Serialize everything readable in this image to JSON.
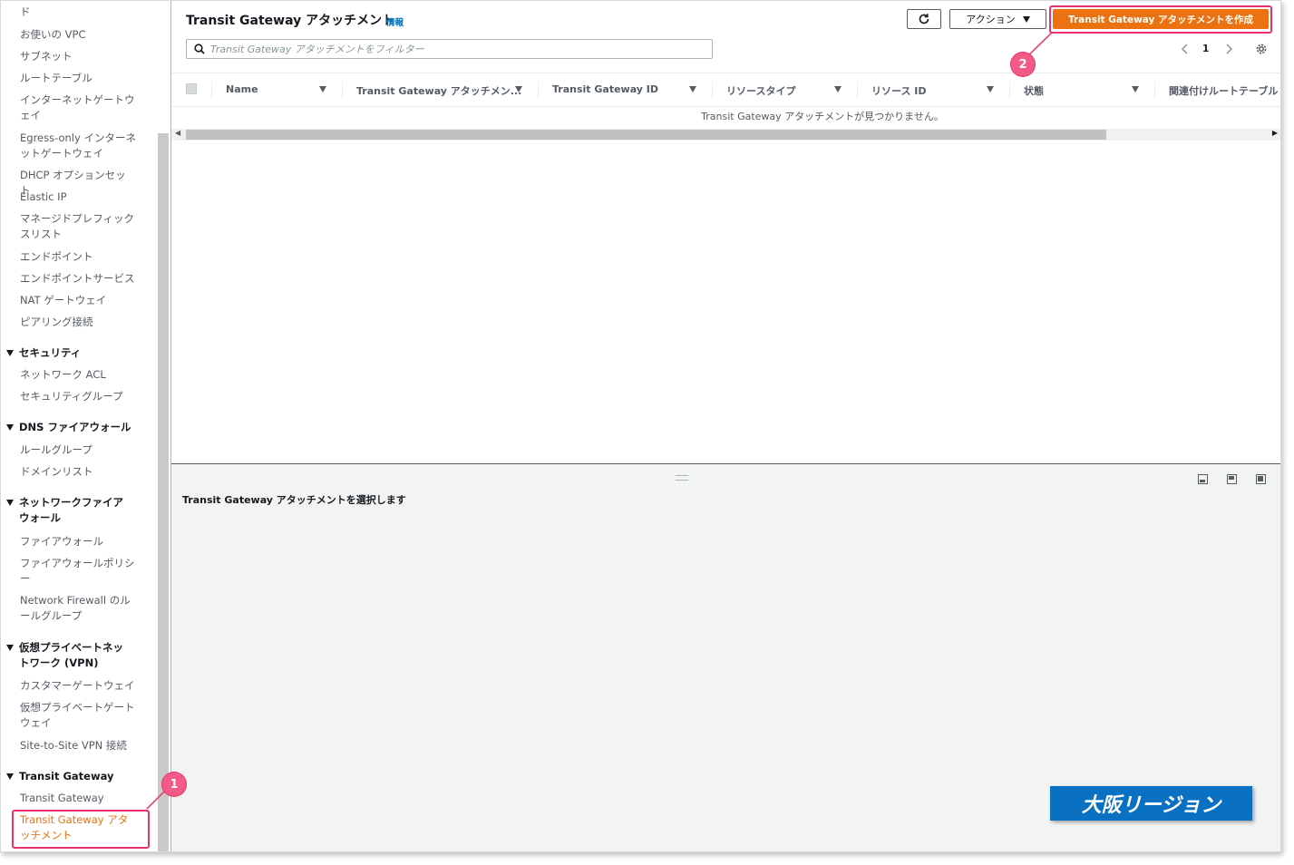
{
  "sidebar": {
    "partial_top": "ド",
    "items": [
      {
        "label": "お使いの VPC"
      },
      {
        "label": "サブネット"
      },
      {
        "label": "ルートテーブル"
      },
      {
        "label": "インターネットゲートウェイ"
      },
      {
        "label": "Egress-only インターネットゲートウェイ"
      },
      {
        "label": "DHCP オプションセット"
      },
      {
        "label": "Elastic IP"
      },
      {
        "label": "マネージドプレフィックスリスト"
      },
      {
        "label": "エンドポイント"
      },
      {
        "label": "エンドポイントサービス"
      },
      {
        "label": "NAT ゲートウェイ"
      },
      {
        "label": "ピアリング接続"
      }
    ],
    "sections": [
      {
        "title": "セキュリティ",
        "items": [
          "ネットワーク ACL",
          "セキュリティグループ"
        ]
      },
      {
        "title": "DNS ファイアウォール",
        "items": [
          "ルールグループ",
          "ドメインリスト"
        ]
      },
      {
        "title": "ネットワークファイアウォール",
        "items": [
          "ファイアウォール",
          "ファイアウォールポリシー",
          "Network Firewall のルールグループ"
        ]
      },
      {
        "title": "仮想プライベートネットワーク (VPN)",
        "items": [
          "カスタマーゲートウェイ",
          "仮想プライベートゲートウェイ",
          "Site-to-Site VPN 接続"
        ]
      },
      {
        "title": "Transit Gateway",
        "items": [
          "Transit Gateway",
          "Transit Gateway アタッチメント"
        ]
      }
    ],
    "active_item": "Transit Gateway アタッチメント"
  },
  "main": {
    "title": "Transit Gateway アタッチメント",
    "info": "情報",
    "actions_label": "アクション",
    "create_label": "Transit Gateway アタッチメントを作成",
    "search_placeholder": "Transit Gateway アタッチメントをフィルター",
    "page": "1",
    "columns": [
      "Name",
      "Transit Gateway アタッチメン...",
      "Transit Gateway ID",
      "リソースタイプ",
      "リソース ID",
      "状態",
      "関連付けルートテーブル"
    ],
    "empty_message": "Transit Gateway アタッチメントが見つかりません。",
    "split_title": "Transit Gateway アタッチメントを選択します"
  },
  "annotations": {
    "callout_1": "1",
    "callout_2": "2",
    "region_badge": "大阪リージョン",
    "highlight_color": "#e8336b",
    "badge_color": "#0a70c2"
  },
  "colors": {
    "primary": "#ec7211",
    "link": "#0073bb"
  }
}
